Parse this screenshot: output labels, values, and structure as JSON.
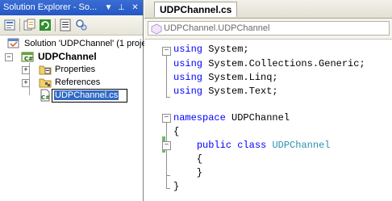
{
  "solution_explorer": {
    "title": "Solution Explorer - So...",
    "title_buttons": [
      "▼",
      "⊥",
      "✕"
    ],
    "tree": {
      "solution": "Solution 'UDPChannel' (1 proje",
      "project": "UDPChannel",
      "properties": "Properties",
      "references": "References",
      "rename_value": "UDPChannel.cs"
    }
  },
  "editor": {
    "tab": "UDPChannel.cs",
    "nav_selection": "UDPChannel.UDPChannel",
    "outline_markers": [
      "−",
      "−",
      "−"
    ],
    "lines": [
      [
        {
          "k": "kw",
          "t": "using"
        },
        {
          "t": " System;"
        }
      ],
      [
        {
          "k": "kw",
          "t": "using"
        },
        {
          "t": " System.Collections.Generic;"
        }
      ],
      [
        {
          "k": "kw",
          "t": "using"
        },
        {
          "t": " System.Linq;"
        }
      ],
      [
        {
          "k": "kw",
          "t": "using"
        },
        {
          "t": " System.Text;"
        }
      ],
      [],
      [
        {
          "k": "kw",
          "t": "namespace"
        },
        {
          "t": " UDPChannel"
        }
      ],
      [
        {
          "t": "{"
        }
      ],
      [
        {
          "t": "    "
        },
        {
          "k": "kw",
          "t": "public"
        },
        {
          "t": " "
        },
        {
          "k": "kw",
          "t": "class"
        },
        {
          "t": " "
        },
        {
          "k": "ty",
          "t": "UDPChannel"
        }
      ],
      [
        {
          "t": "    {"
        }
      ],
      [
        {
          "t": "    }"
        }
      ],
      [
        {
          "t": "}"
        }
      ]
    ]
  }
}
